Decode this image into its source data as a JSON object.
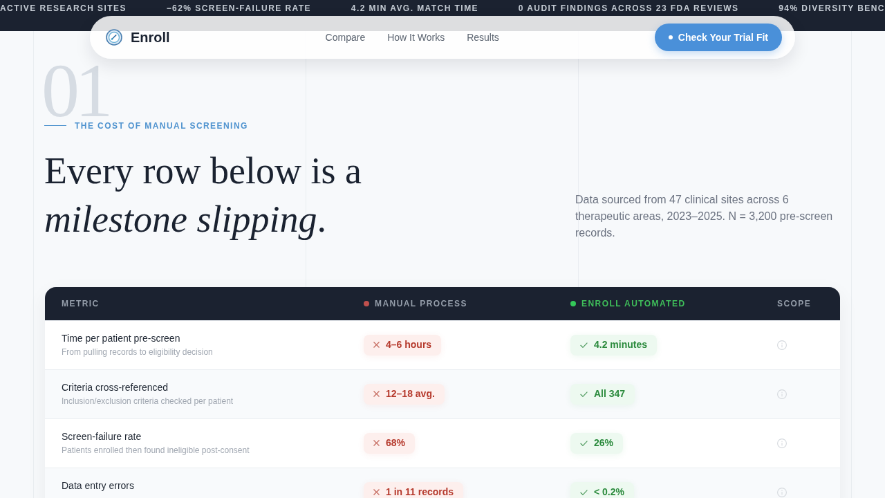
{
  "ticker": [
    "ACTIVE RESEARCH SITES",
    "−62% SCREEN-FAILURE RATE",
    "4.2 MIN AVG. MATCH TIME",
    "0 AUDIT FINDINGS ACROSS 23 FDA REVIEWS",
    "94% DIVERSITY BENC"
  ],
  "nav": {
    "brand": "Enroll",
    "links": [
      "Compare",
      "How It Works",
      "Results"
    ],
    "cta": "Check Your Trial Fit"
  },
  "section": {
    "number": "01",
    "eyebrow": "THE COST OF MANUAL SCREENING",
    "heading": "Every row below is a *milestone slipping*.",
    "note": "Data sourced from 47 clinical sites across 6 therapeutic areas, 2023–2025. N = 3,200 pre-screen records."
  },
  "table": {
    "columns": [
      {
        "label": "METRIC",
        "highlighted": false
      },
      {
        "label": "MANUAL PROCESS",
        "color": "#c0504d",
        "highlighted": false
      },
      {
        "label": "ENROLL AUTOMATED",
        "color": "#34c759",
        "highlighted": true
      },
      {
        "label": "SCOPE",
        "highlighted": false
      }
    ],
    "rows": [
      {
        "metric": "Time per patient pre-screen",
        "description": "From pulling records to eligibility decision",
        "manual": {
          "text": "4–6 hours",
          "kind": "fail"
        },
        "automated": {
          "text": "4.2 minutes",
          "kind": "pass"
        }
      },
      {
        "metric": "Criteria cross-referenced",
        "description": "Inclusion/exclusion criteria checked per patient",
        "manual": {
          "text": "12–18 avg.",
          "kind": "fail"
        },
        "automated": {
          "text": "All 347",
          "kind": "pass"
        }
      },
      {
        "metric": "Screen-failure rate",
        "description": "Patients enrolled then found ineligible post-consent",
        "manual": {
          "text": "68%",
          "kind": "fail"
        },
        "automated": {
          "text": "26%",
          "kind": "pass"
        }
      },
      {
        "metric": "Data entry errors",
        "manual": {
          "text": "1 in 11 records",
          "kind": "fail"
        },
        "automated": {
          "text": "< 0.2%",
          "kind": "pass"
        }
      }
    ]
  }
}
